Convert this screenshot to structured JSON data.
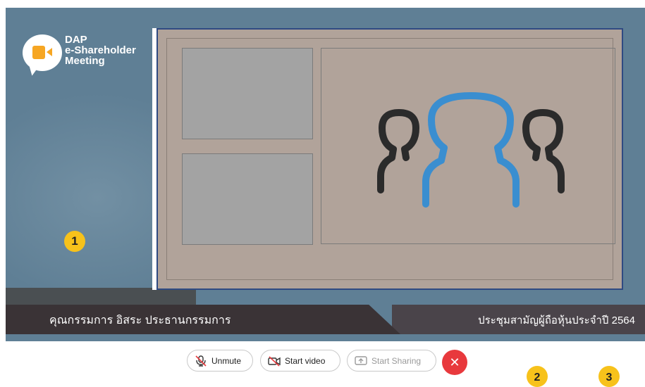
{
  "logo": {
    "line1": "DAP",
    "line2": "e-Shareholder",
    "line3": "Meeting",
    "icon": "video-camera-icon",
    "accent_color": "#f6a623"
  },
  "markers": {
    "main": "1",
    "bottom_a": "2",
    "bottom_b": "3"
  },
  "lower_third": {
    "speaker_name": "คุณกรรมการ อิสระ ประธานกรรมการ",
    "meeting_title": "ประชุมสามัญผู้ถือหุ้นประจำปี 2564"
  },
  "controls": {
    "unmute": {
      "label": "Unmute",
      "icon": "mic-off-icon"
    },
    "start_video": {
      "label": "Start video",
      "icon": "video-off-icon"
    },
    "start_sharing": {
      "label": "Start Sharing",
      "icon": "share-screen-icon"
    },
    "end_call": {
      "icon": "close-icon",
      "glyph": "✕",
      "color": "#e8393d"
    }
  },
  "colors": {
    "stage": "#5f7f95",
    "frame_border": "#2f4a82",
    "people_primary": "#3a8ed0",
    "people_secondary": "#2b2b2b"
  }
}
